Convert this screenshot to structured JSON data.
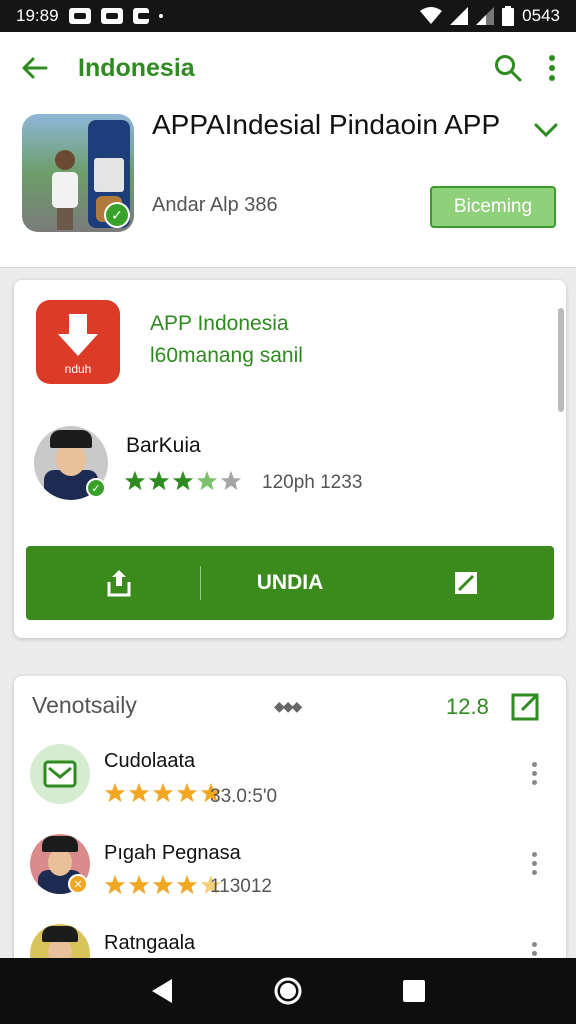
{
  "status_bar": {
    "time": "19:89",
    "right_time": "0543"
  },
  "header": {
    "title": "Indonesia"
  },
  "app": {
    "name": "APPAIndesial Pindaoin APP",
    "developer_line": "Andar Alp 386",
    "action_label": "Biceming"
  },
  "card1": {
    "icon_label": "nduh",
    "title": "APP Indonesia",
    "subtitle": "l60manang sanil",
    "dev_name": "BarKuia",
    "rating_stars": 3.5,
    "rating_text": "120ph 1233",
    "main_button_label": "UNDIA"
  },
  "section": {
    "title": "Venotsaily",
    "count": "12.8",
    "items": [
      {
        "name": "Cudolaata",
        "rating_stars": 5,
        "rating_text": "33.0:5'0"
      },
      {
        "name": "Pıgah Pegnasa",
        "rating_stars": 4.5,
        "rating_text": "113012"
      },
      {
        "name": "Ratngaala"
      }
    ]
  },
  "colors": {
    "accent": "#2e8b1f",
    "button": "#3a8b1c",
    "status": "#151515"
  }
}
